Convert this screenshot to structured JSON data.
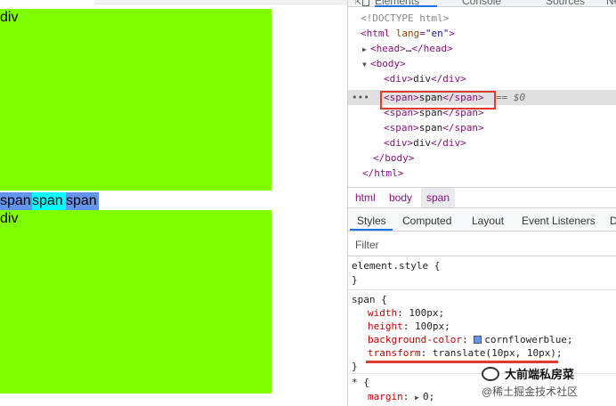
{
  "page": {
    "div1_text": "div",
    "spans": [
      "span",
      "span",
      "span"
    ],
    "div2_text": "div",
    "colors": {
      "div_bg": "#7fff00",
      "span_bg": "#6495ed",
      "span_hover_bg": "#00ffff"
    }
  },
  "devtools": {
    "tabs": [
      "Elements",
      "Console",
      "Sources",
      "Ne"
    ],
    "active_tab": "Elements",
    "dom": {
      "doctype": "<!DOCTYPE html>",
      "html_open_tag": "html",
      "lang_attr": "lang",
      "lang_value": "\"en\"",
      "head": "head",
      "head_ellipsis": "…",
      "body": "body",
      "div": "div",
      "div_text": "div",
      "span": "span",
      "span_text": "span",
      "selected_suffix": "== $0",
      "dots": "•••"
    },
    "breadcrumbs": [
      "html",
      "body",
      "span"
    ],
    "pane_tabs": [
      "Styles",
      "Computed",
      "Layout",
      "Event Listeners",
      "D"
    ],
    "filter_placeholder": "Filter",
    "element_style": {
      "selector": "element.style {",
      "close": "}"
    },
    "span_rule": {
      "selector": "span {",
      "props": [
        {
          "name": "width",
          "value": "100px;"
        },
        {
          "name": "height",
          "value": "100px;"
        },
        {
          "name": "background-color",
          "value": "cornflowerblue;"
        },
        {
          "name": "transform",
          "value": "translate(10px, 10px);"
        }
      ],
      "close": "}"
    },
    "star_rule": {
      "selector": "* {",
      "prop": "margin",
      "value": "0;"
    }
  },
  "watermark": {
    "line1": "大前端私房菜",
    "line2": "@稀土掘金技术社区"
  },
  "accent": {
    "highlight_red": "#e03a2f",
    "tab_blue": "#1a73e8"
  }
}
